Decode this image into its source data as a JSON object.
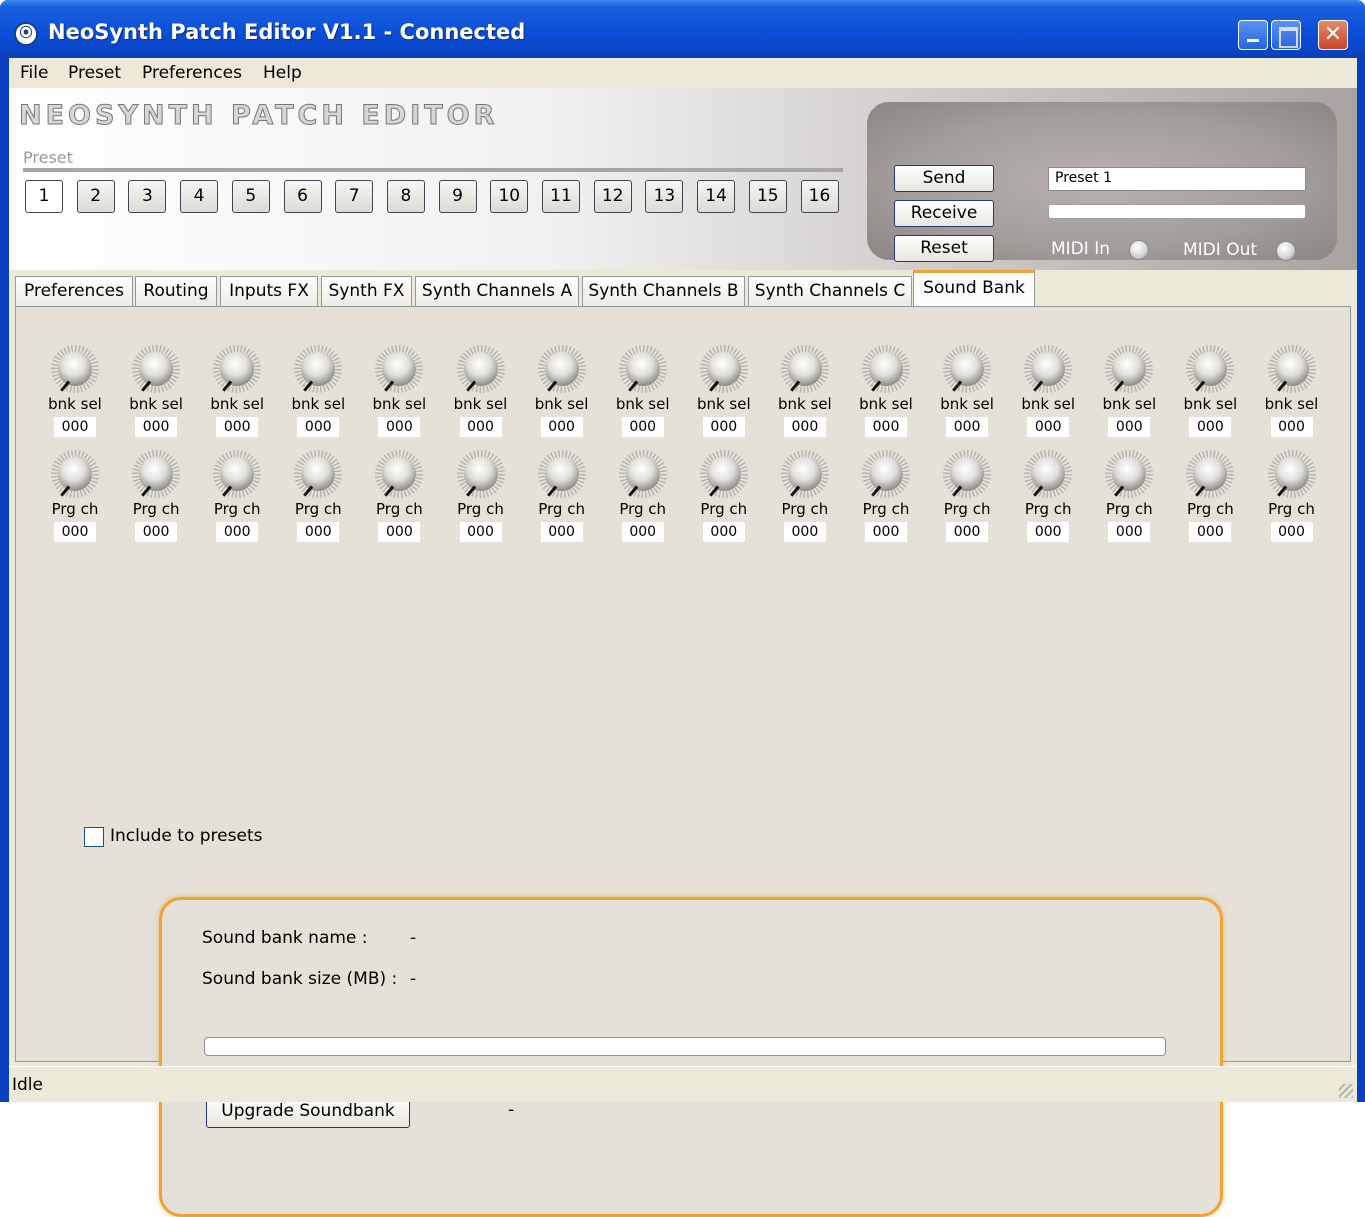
{
  "window": {
    "title": "NeoSynth Patch Editor V1.1 - Connected",
    "app_icon": "midi-connector-icon",
    "controls": {
      "minimize": "minimize-icon",
      "maximize": "maximize-icon",
      "close": "close-icon",
      "close_glyph": "✕"
    }
  },
  "menu": [
    "File",
    "Preset",
    "Preferences",
    "Help"
  ],
  "header": {
    "logo": "NEOSYNTH PATCH EDITOR",
    "preset_label": "Preset",
    "preset_buttons": [
      "1",
      "2",
      "3",
      "4",
      "5",
      "6",
      "7",
      "8",
      "9",
      "10",
      "11",
      "12",
      "13",
      "14",
      "15",
      "16"
    ],
    "active_preset": "1",
    "send_label": "Send",
    "receive_label": "Receive",
    "reset_label": "Reset",
    "preset_name": "Preset 1",
    "transfer_progress": 0,
    "midi_in_label": "MIDI In",
    "midi_out_label": "MIDI Out"
  },
  "tabs": [
    "Preferences",
    "Routing",
    "Inputs FX",
    "Synth FX",
    "Synth Channels A",
    "Synth Channels B",
    "Synth Channels C",
    "Sound Bank"
  ],
  "active_tab": "Sound Bank",
  "sound_bank": {
    "knob_rows": [
      {
        "label": "bnk sel",
        "values": [
          "000",
          "000",
          "000",
          "000",
          "000",
          "000",
          "000",
          "000",
          "000",
          "000",
          "000",
          "000",
          "000",
          "000",
          "000",
          "000"
        ]
      },
      {
        "label": "Prg ch",
        "values": [
          "000",
          "000",
          "000",
          "000",
          "000",
          "000",
          "000",
          "000",
          "000",
          "000",
          "000",
          "000",
          "000",
          "000",
          "000",
          "000"
        ]
      }
    ],
    "include_label": "Include to presets",
    "include_checked": false,
    "name_label": "Sound bank name :",
    "name_value": "-",
    "size_label": "Sound bank size (MB) :",
    "size_value": "-",
    "upgrade_progress": 0,
    "upgrade_label": "Upgrade Soundbank",
    "upgrade_status": "-"
  },
  "status": "Idle",
  "colors": {
    "title_blue": "#0b4fd8",
    "accent_orange": "#f0a232",
    "panel_bg": "#e5e1d8"
  }
}
